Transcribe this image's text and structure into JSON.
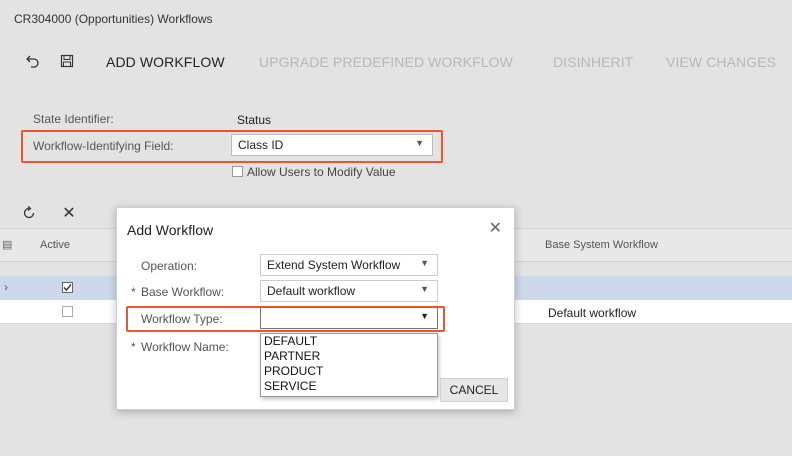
{
  "window": {
    "title": "CR304000 (Opportunities) Workflows"
  },
  "toolbar": {
    "undo_icon": "undo-icon",
    "save_icon": "save-icon",
    "add_workflow": "ADD WORKFLOW",
    "upgrade_predefined": "UPGRADE PREDEFINED WORKFLOW",
    "disinherit": "DISINHERIT",
    "view_changes": "VIEW CHANGES"
  },
  "form": {
    "state_identifier_label": "State Identifier:",
    "state_identifier_value": "Status",
    "workflow_field_label": "Workflow-Identifying Field:",
    "workflow_field_value": "Class ID",
    "allow_modify_label": "Allow Users to Modify Value"
  },
  "grid": {
    "columns": [
      "Active",
      "Base System Workflow"
    ],
    "rows": [
      {
        "active": true,
        "base_system_workflow": ""
      },
      {
        "active": false,
        "base_system_workflow": "Default workflow"
      }
    ]
  },
  "dialog": {
    "title": "Add Workflow",
    "operation_label": "Operation:",
    "operation_value": "Extend System Workflow",
    "base_workflow_label": "Base Workflow:",
    "base_workflow_value": "Default workflow",
    "workflow_type_label": "Workflow Type:",
    "workflow_type_value": "",
    "workflow_name_label": "Workflow Name:",
    "workflow_type_options": [
      "DEFAULT",
      "PARTNER",
      "PRODUCT",
      "SERVICE"
    ],
    "cancel_label": "CANCEL",
    "required_marker": "*"
  },
  "colors": {
    "highlight": "#e8582e",
    "selected_row": "#cdd9e8"
  }
}
